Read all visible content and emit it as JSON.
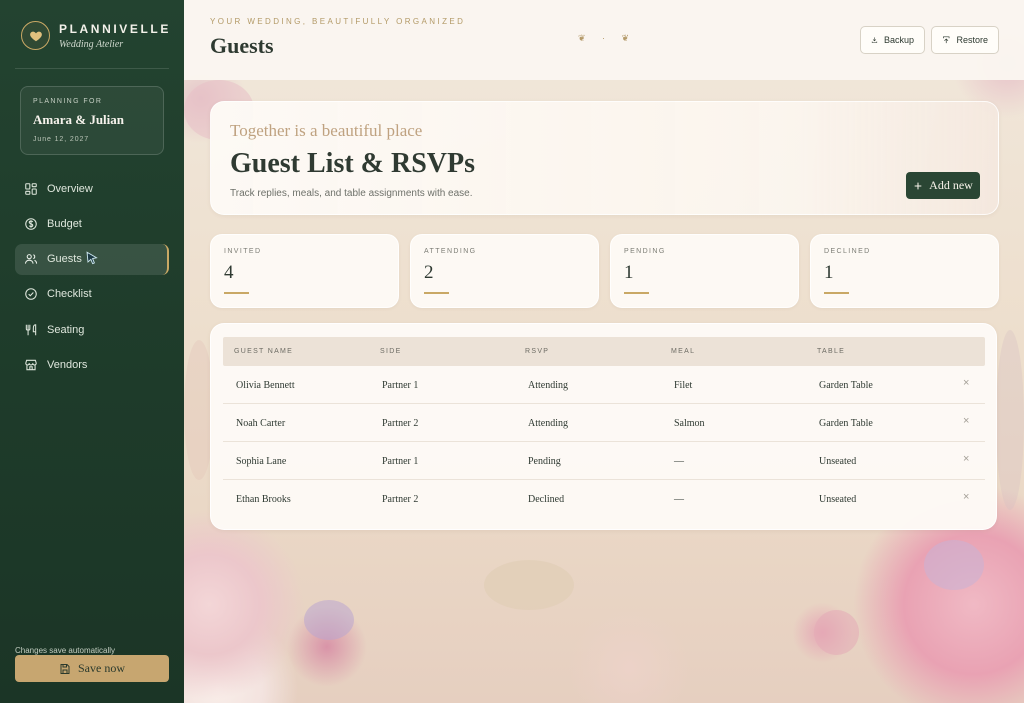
{
  "brand": {
    "name": "PLANNIVELLE",
    "subtitle": "Wedding Atelier"
  },
  "planning": {
    "eyebrow": "PLANNING FOR",
    "couple": "Amara & Julian",
    "date": "June 12, 2027"
  },
  "nav": {
    "items": [
      {
        "label": "Overview",
        "icon": "grid-icon",
        "active": false
      },
      {
        "label": "Budget",
        "icon": "dollar-circle-icon",
        "active": false
      },
      {
        "label": "Guests",
        "icon": "users-icon",
        "active": true
      },
      {
        "label": "Checklist",
        "icon": "check-circle-icon",
        "active": false
      },
      {
        "label": "Seating",
        "icon": "utensils-icon",
        "active": false
      },
      {
        "label": "Vendors",
        "icon": "store-icon",
        "active": false
      }
    ]
  },
  "footer": {
    "autosave": "Changes save automatically",
    "save_label": "Save now"
  },
  "header": {
    "eyebrow": "YOUR WEDDING, BEAUTIFULLY ORGANIZED",
    "title": "Guests",
    "ornament": "❦ · ❦",
    "backup_label": "Backup",
    "restore_label": "Restore"
  },
  "hero": {
    "kicker": "Together is a beautiful place",
    "title": "Guest List & RSVPs",
    "subtitle": "Track replies, meals, and table assignments with ease.",
    "add_label": "Add new"
  },
  "stats": [
    {
      "label": "INVITED",
      "value": "4"
    },
    {
      "label": "ATTENDING",
      "value": "2"
    },
    {
      "label": "PENDING",
      "value": "1"
    },
    {
      "label": "DECLINED",
      "value": "1"
    }
  ],
  "table": {
    "columns": [
      "GUEST NAME",
      "SIDE",
      "RSVP",
      "MEAL",
      "TABLE"
    ],
    "rows": [
      {
        "name": "Olivia Bennett",
        "side": "Partner 1",
        "rsvp": "Attending",
        "meal": "Filet",
        "table": "Garden Table"
      },
      {
        "name": "Noah Carter",
        "side": "Partner 2",
        "rsvp": "Attending",
        "meal": "Salmon",
        "table": "Garden Table"
      },
      {
        "name": "Sophia Lane",
        "side": "Partner 1",
        "rsvp": "Pending",
        "meal": "—",
        "table": "Unseated"
      },
      {
        "name": "Ethan Brooks",
        "side": "Partner 2",
        "rsvp": "Declined",
        "meal": "—",
        "table": "Unseated"
      }
    ],
    "delete_glyph": "×"
  },
  "colors": {
    "sidebar": "#1e3b2a",
    "accent_gold": "#c9a865",
    "primary_button": "#2a4634",
    "save_button": "#c7a670"
  }
}
